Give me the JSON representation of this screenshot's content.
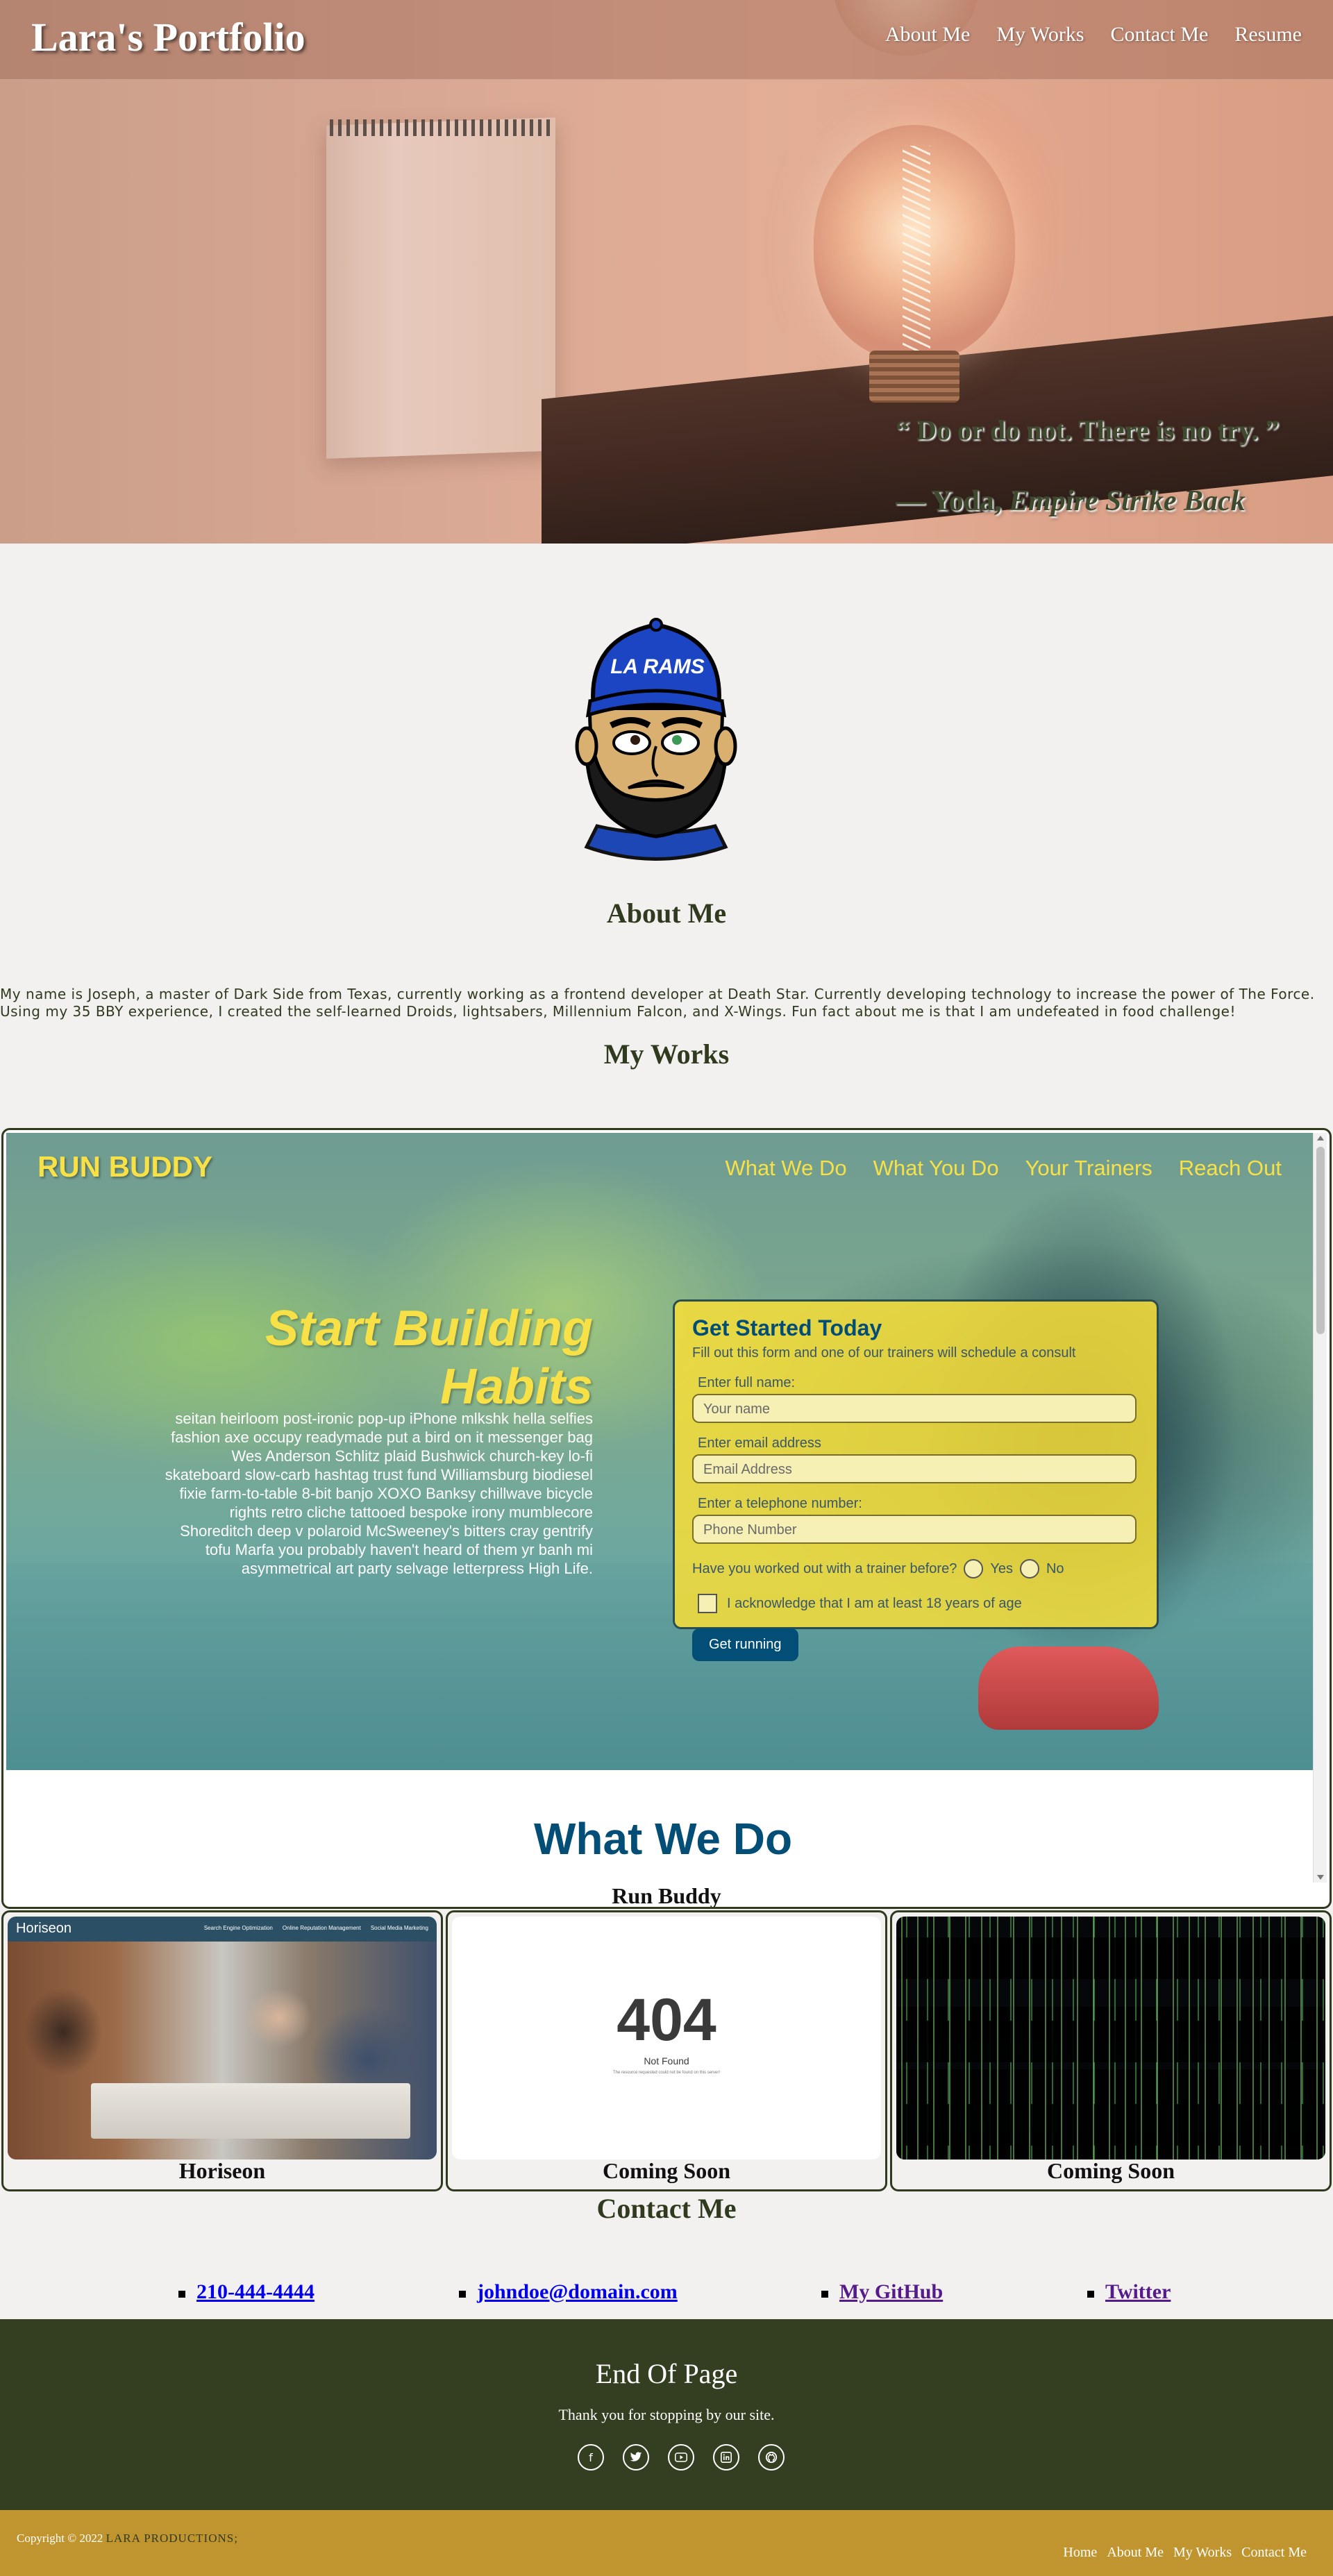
{
  "header": {
    "brand": "Lara's Portfolio",
    "nav": [
      "About Me",
      "My Works",
      "Contact Me",
      "Resume"
    ]
  },
  "hero": {
    "quote": "“ Do or do not. There is no try. ”",
    "attribution_prefix": "— Yoda, ",
    "attribution_work": "Empire Strike Back"
  },
  "about": {
    "heading": "About Me",
    "text": "My name is Joseph, a master of Dark Side from Texas, currently working as a frontend developer at Death Star. Currently developing technology to increase the power of The Force. Using my 35 BBY experience, I created the self-learned Droids, lightsabers, Millennium Falcon, and X-Wings. Fun fact about me is that I am undefeated in food challenge!",
    "avatar_cap_text": "LA RAMS"
  },
  "works": {
    "heading": "My Works",
    "featured": {
      "caption": "Run Buddy",
      "site": {
        "logo": "RUN BUDDY",
        "nav": [
          "What We Do",
          "What You Do",
          "Your Trainers",
          "Reach Out"
        ],
        "title": "Start Building Habits",
        "body": "seitan heirloom post-ironic pop-up iPhone mlkshk hella selfies fashion axe occupy readymade put a bird on it messenger bag Wes Anderson Schlitz plaid Bushwick church-key lo-fi skateboard slow-carb hashtag trust fund Williamsburg biodiesel fixie farm-to-table 8-bit banjo XOXO Banksy chillwave bicycle rights retro cliche tattooed bespoke irony mumblecore Shoreditch deep v polaroid McSweeney's bitters cray gentrify tofu Marfa you probably haven't heard of them yr banh mi asymmetrical art party selvage letterpress High Life.",
        "form": {
          "title": "Get Started Today",
          "subtitle": "Fill out this form and one of our trainers will schedule a consult",
          "name_label": "Enter full name:",
          "name_placeholder": "Your name",
          "email_label": "Enter email address",
          "email_placeholder": "Email Address",
          "phone_label": "Enter a telephone number:",
          "phone_placeholder": "Phone Number",
          "trainer_question": "Have you worked out with a trainer before?",
          "yes": "Yes",
          "no": "No",
          "acknowledge": "I acknowledge that I am at least 18 years of age",
          "button": "Get running"
        },
        "next_heading": "What We Do"
      }
    },
    "cards": [
      {
        "caption": "Horiseon",
        "logo": "Horiseon",
        "nav": [
          "Search Engine Optimization",
          "Online Reputation Management",
          "Social Media Marketing"
        ]
      },
      {
        "caption": "Coming Soon",
        "code": "404",
        "title": "Not Found",
        "small": "The resource requested could not be found on this server!"
      },
      {
        "caption": "Coming Soon"
      }
    ]
  },
  "contact": {
    "heading": "Contact Me",
    "items": [
      "210-444-4444",
      "johndoe@domain.com",
      "My GitHub",
      "Twitter"
    ]
  },
  "footer": {
    "title": "End Of Page",
    "thanks": "Thank you for stopping by our site.",
    "social_icons": [
      "facebook-icon",
      "twitter-icon",
      "youtube-icon",
      "linkedin-icon",
      "github-icon"
    ],
    "copyright_prefix": "Copyright © 2022",
    "copyright_org": "LARA PRODUCTIONS;",
    "nav": [
      "Home",
      "About Me",
      "My Works",
      "Contact Me"
    ]
  },
  "colors": {
    "olive": "#343f22",
    "gold": "#c0952f",
    "runbuddy_yellow": "#f8e146",
    "runbuddy_blue": "#024e76"
  }
}
